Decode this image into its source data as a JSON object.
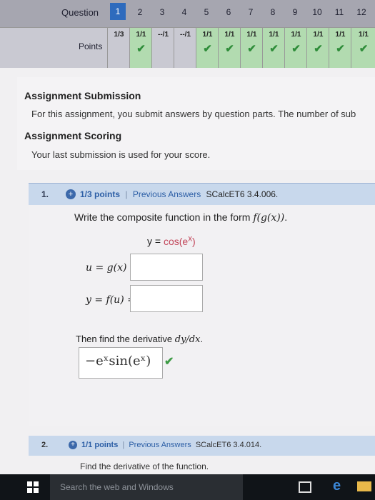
{
  "question_table": {
    "question_label": "Question",
    "points_label": "Points",
    "questions": [
      "1",
      "2",
      "3",
      "4",
      "5",
      "6",
      "7",
      "8",
      "9",
      "10",
      "11",
      "12"
    ],
    "points": [
      "1/3",
      "1/1",
      "--/1",
      "--/1",
      "1/1",
      "1/1",
      "1/1",
      "1/1",
      "1/1",
      "1/1",
      "1/1",
      "1/1"
    ],
    "checks": [
      false,
      true,
      false,
      false,
      true,
      true,
      true,
      true,
      true,
      true,
      true,
      true
    ],
    "check_symbol": "✔"
  },
  "submission": {
    "heading": "Assignment Submission",
    "text": "For this assignment, you submit answers by question parts. The number of sub",
    "scoring_heading": "Assignment Scoring",
    "scoring_text": "Your last submission is used for your score."
  },
  "q1": {
    "number": "1.",
    "plus": "+",
    "points": "1/3 points",
    "sep": "|",
    "prev": "Previous Answers",
    "code": "SCalcET6 3.4.006.",
    "prompt_lead": "Write the composite function in the form ",
    "prompt_math": "f(g(x))",
    "prompt_end": ".",
    "y_left": "y = ",
    "y_func": "cos(e",
    "y_exp": "x",
    "y_close": ")",
    "u_label": "u = g(x) =",
    "y2_label": "y = f(u) =",
    "then_text": "Then find the derivative ",
    "then_math": "dy/dx",
    "then_end": ".",
    "deriv_answer": "−eˣsin(eˣ)",
    "check": "✔"
  },
  "q2": {
    "number": "2.",
    "plus": "+",
    "points": "1/1 points",
    "sep": "|",
    "prev": "Previous Answers",
    "code": "SCalcET6 3.4.014.",
    "prompt": "Find the derivative of the function."
  },
  "taskbar": {
    "search_placeholder": "Search the web and Windows",
    "edge_letter": "e"
  }
}
